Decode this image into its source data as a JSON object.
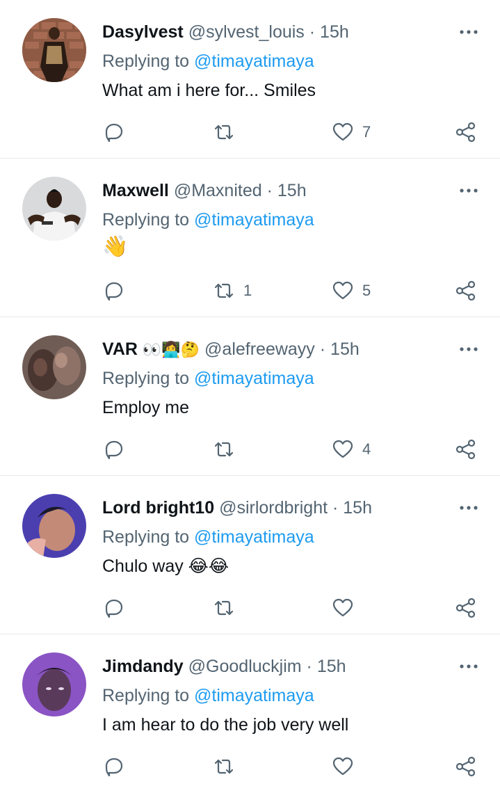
{
  "colors": {
    "link": "#1d9bf0",
    "muted": "#536471",
    "text": "#0f1419",
    "divider": "#e6e9ec"
  },
  "tweets": [
    {
      "name": "Dasylvest",
      "name_emoji": "",
      "handle": "@sylvest_louis",
      "separator": "·",
      "time": "15h",
      "replying_prefix": "Replying to",
      "replying_to": "@timayatimaya",
      "text": "What am i here for... Smiles",
      "retweets": "",
      "likes": "7",
      "avatar_icon": "avatar-photo"
    },
    {
      "name": "Maxwell",
      "name_emoji": "",
      "handle": "@Maxnited",
      "separator": "·",
      "time": "15h",
      "replying_prefix": "Replying to",
      "replying_to": "@timayatimaya",
      "text": "👋",
      "retweets": "1",
      "likes": "5",
      "avatar_icon": "avatar-photo"
    },
    {
      "name": "VAR",
      "name_emoji": "👀👩‍💻🤔",
      "handle": "@alefreewayy",
      "separator": "·",
      "time": "15h",
      "replying_prefix": "Replying to",
      "replying_to": "@timayatimaya",
      "text": "Employ me",
      "retweets": "",
      "likes": "4",
      "avatar_icon": "avatar-photo"
    },
    {
      "name": "Lord bright10",
      "name_emoji": "",
      "handle": "@sirlordbright",
      "separator": "·",
      "time": "15h",
      "replying_prefix": "Replying to",
      "replying_to": "@timayatimaya",
      "text": "Chulo way 😂😂",
      "retweets": "",
      "likes": "",
      "avatar_icon": "avatar-photo"
    },
    {
      "name": "Jimdandy",
      "name_emoji": "",
      "handle": "@Goodluckjim",
      "separator": "·",
      "time": "15h",
      "replying_prefix": "Replying to",
      "replying_to": "@timayatimaya",
      "text": "I am hear to do the job very well",
      "retweets": "",
      "likes": "",
      "avatar_icon": "avatar-photo"
    }
  ]
}
